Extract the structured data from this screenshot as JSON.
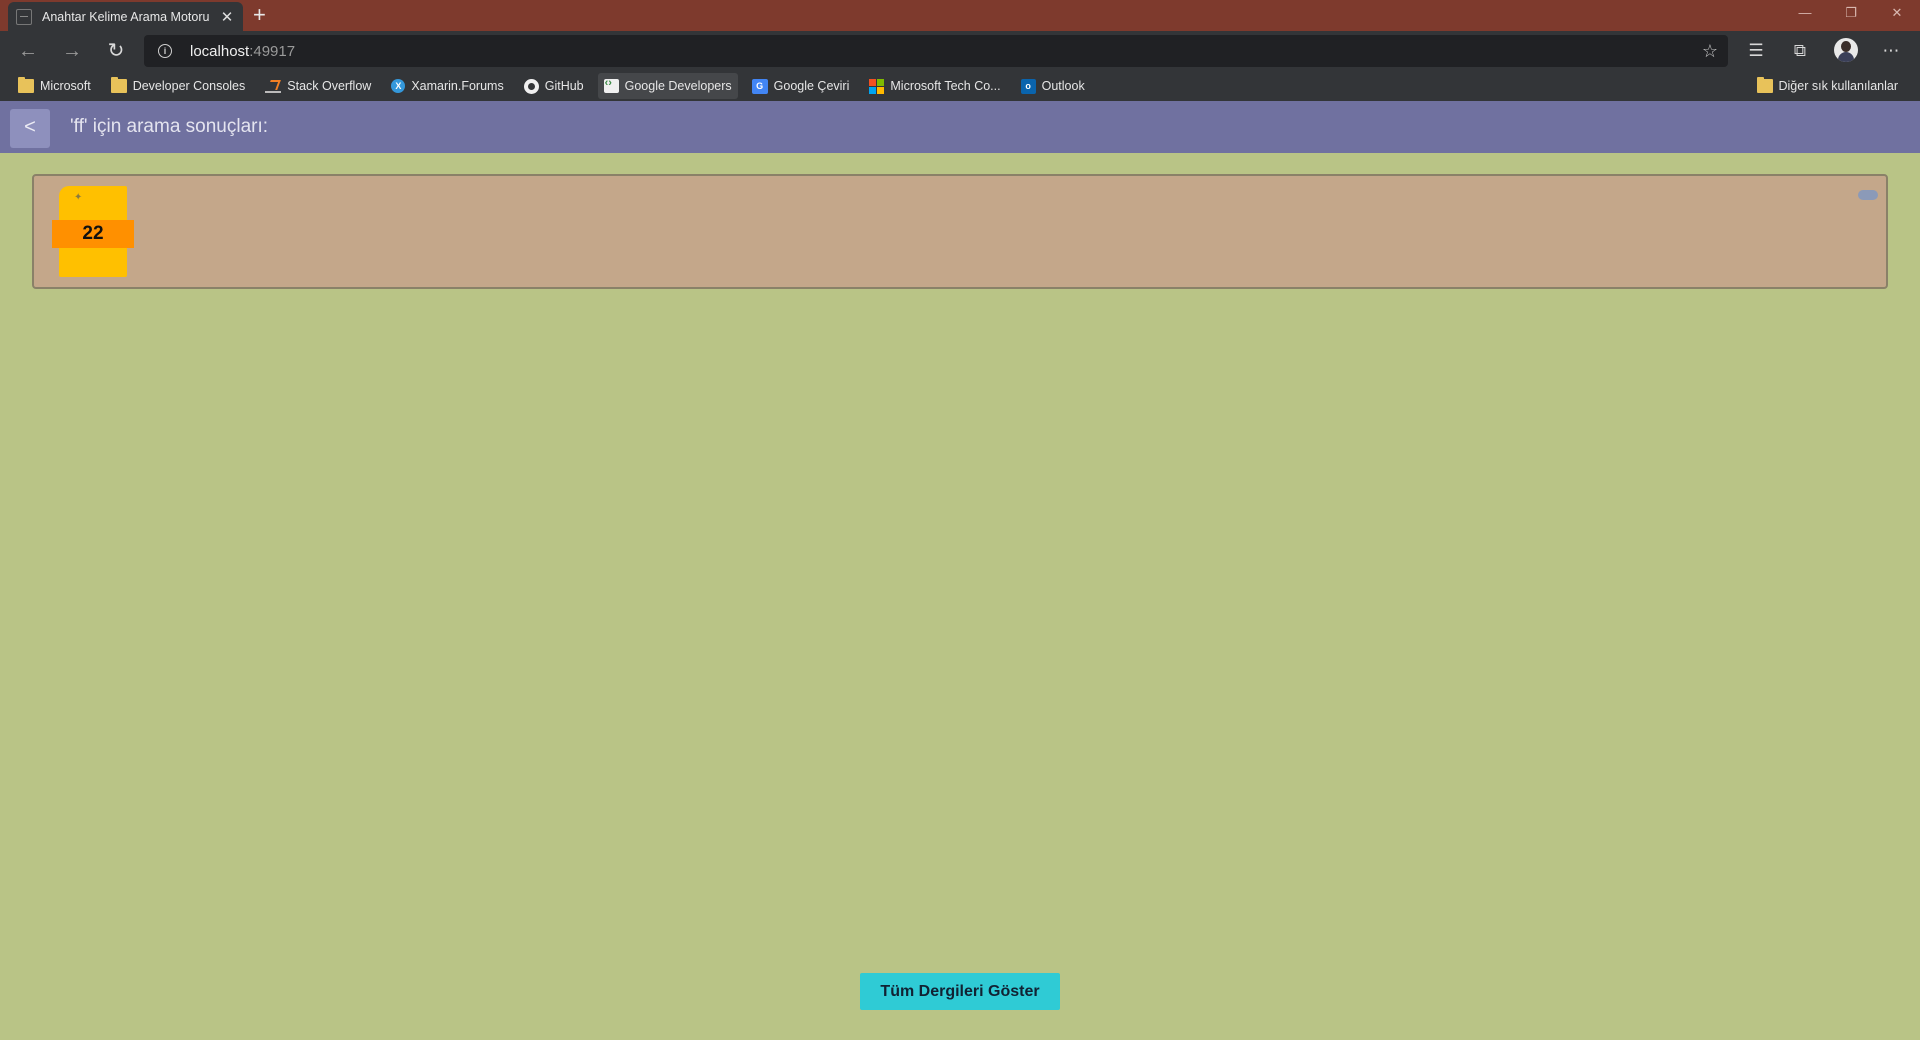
{
  "browser": {
    "tab_title": "Anahtar Kelime Arama Motoru",
    "tab_close": "✕",
    "new_tab": "+",
    "url_host": "localhost",
    "url_port": ":49917",
    "window_controls": {
      "minimize": "—",
      "restore": "❐",
      "close": "✕"
    }
  },
  "bookmarks": {
    "items": [
      {
        "label": "Microsoft",
        "icon": "folder-icon"
      },
      {
        "label": "Developer Consoles",
        "icon": "folder-icon"
      },
      {
        "label": "Stack Overflow",
        "icon": "stackoverflow-icon"
      },
      {
        "label": "Xamarin.Forums",
        "icon": "xamarin-icon"
      },
      {
        "label": "GitHub",
        "icon": "github-icon"
      },
      {
        "label": "Google Developers",
        "icon": "google-developers-icon"
      },
      {
        "label": "Google Çeviri",
        "icon": "google-translate-icon"
      },
      {
        "label": "Microsoft Tech Co...",
        "icon": "microsoft-icon"
      },
      {
        "label": "Outlook",
        "icon": "outlook-icon"
      }
    ],
    "other": "Diğer sık kullanılanlar"
  },
  "header": {
    "back_label": "<",
    "title": "'ff' için arama sonuçları:"
  },
  "results": [
    {
      "issue_number": "22"
    }
  ],
  "footer": {
    "show_all_label": "Tüm Dergileri Göster"
  },
  "colors": {
    "page_background": "#b9c486",
    "header_background": "#7071a0",
    "card_background": "#c4a78a",
    "button_background": "#2fcbd5",
    "title_bar": "#7e3a2d"
  }
}
